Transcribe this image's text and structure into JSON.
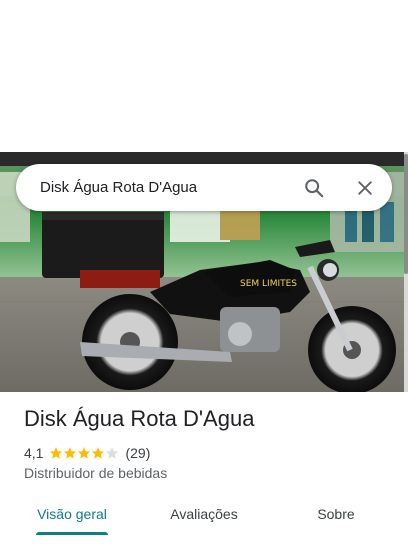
{
  "search": {
    "query": "Disk Água Rota D'Agua",
    "search_icon": "search-icon",
    "close_icon": "close-icon"
  },
  "hero": {
    "description_icon": "motorcycle-photo"
  },
  "place": {
    "name": "Disk Água Rota D'Agua",
    "rating": "4,1",
    "rating_stars": 4.1,
    "review_count": "(29)",
    "category": "Distribuidor de bebidas"
  },
  "tabs": [
    {
      "label": "Visão geral",
      "active": true
    },
    {
      "label": "Avaliações",
      "active": false
    },
    {
      "label": "Sobre",
      "active": false
    }
  ],
  "colors": {
    "accent": "#0e7d88",
    "star": "#fbbc04",
    "star_empty": "#dadce0"
  }
}
